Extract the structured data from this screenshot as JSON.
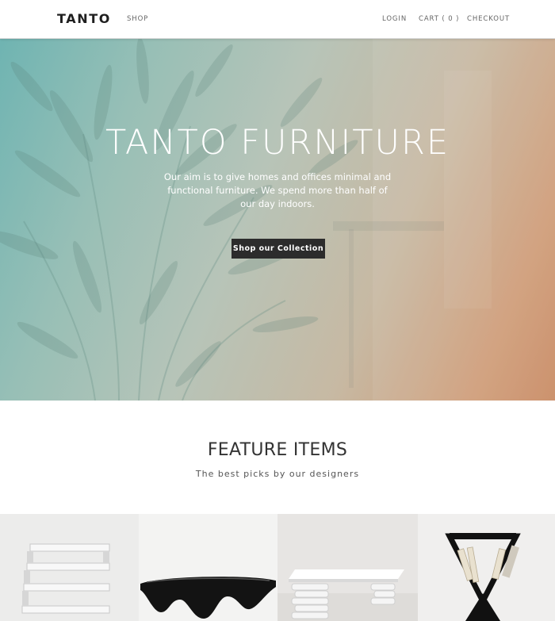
{
  "header": {
    "logo": "TANTO",
    "nav_left": [
      {
        "label": "SHOP"
      }
    ],
    "nav_right": [
      {
        "label": "LOGIN"
      },
      {
        "label": "CART ( 0 )"
      },
      {
        "label": "CHECKOUT"
      }
    ]
  },
  "hero": {
    "title": "TANTO FURNITURE",
    "subtitle": "Our aim is to give homes and offices minimal and functional furniture. We spend more than half of our day indoors.",
    "cta_label": "Shop our Collection"
  },
  "feature": {
    "title": "FEATURE ITEMS",
    "subtitle": "The best picks by our designers"
  },
  "products": [
    {
      "icon": "wall-shelf-image"
    },
    {
      "icon": "wave-bench-image"
    },
    {
      "icon": "stacked-table-image"
    },
    {
      "icon": "magazine-rack-image"
    }
  ],
  "colors": {
    "cta_background": "#2c2c2c",
    "hero_gradient_start": "#6fb4b2",
    "hero_gradient_end": "#c98a63"
  }
}
